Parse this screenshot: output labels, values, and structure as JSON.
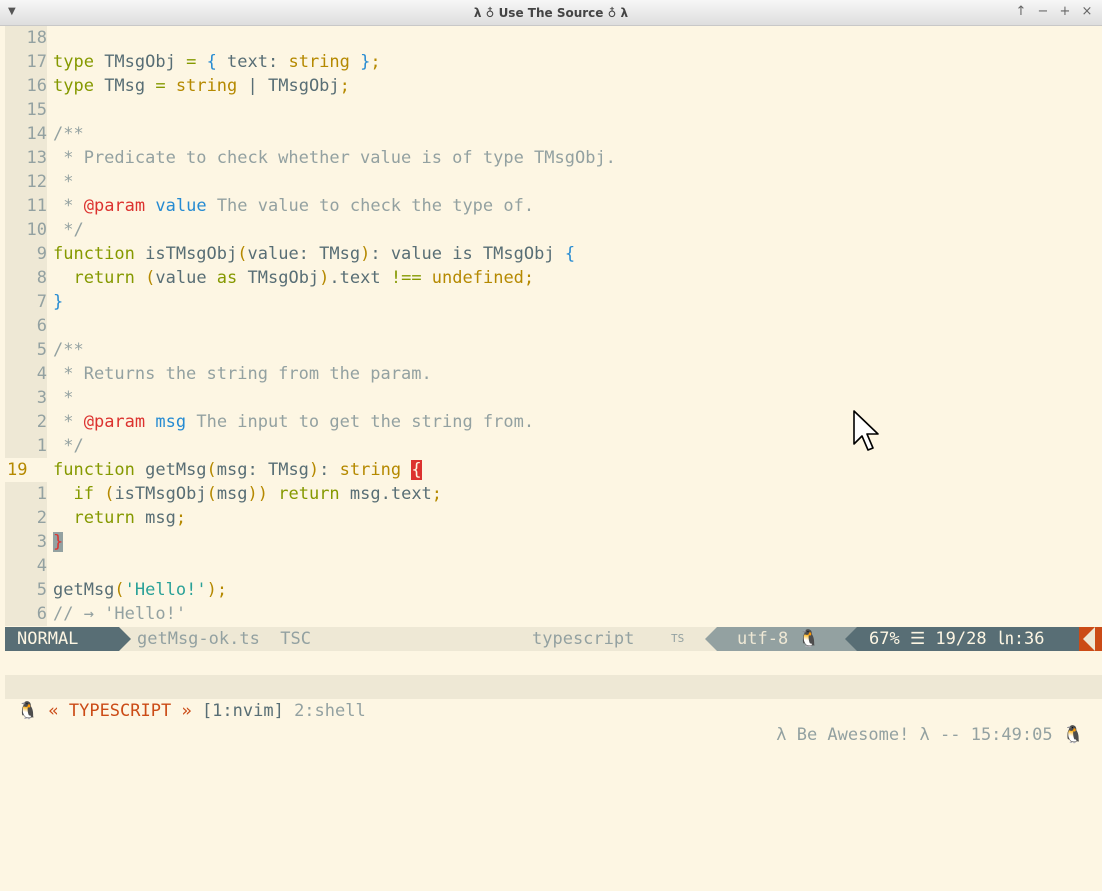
{
  "window": {
    "title": "λ ♁ Use The Source ♁ λ",
    "controls": [
      "↑",
      "−",
      "+",
      "×"
    ]
  },
  "editor": {
    "lines": [
      {
        "num": "18",
        "current": false,
        "segments": []
      },
      {
        "num": "17",
        "current": false,
        "segments": [
          {
            "t": "type ",
            "c": "kw"
          },
          {
            "t": "TMsgObj ",
            "c": "pr"
          },
          {
            "t": "= ",
            "c": "kw"
          },
          {
            "t": "{ ",
            "c": "br"
          },
          {
            "t": "text: ",
            "c": "pr"
          },
          {
            "t": "string ",
            "c": "ty"
          },
          {
            "t": "}",
            "c": "br"
          },
          {
            "t": ";",
            "c": "ty"
          }
        ]
      },
      {
        "num": "16",
        "current": false,
        "segments": [
          {
            "t": "type ",
            "c": "kw"
          },
          {
            "t": "TMsg ",
            "c": "pr"
          },
          {
            "t": "= ",
            "c": "kw"
          },
          {
            "t": "string ",
            "c": "ty"
          },
          {
            "t": "| ",
            "c": "pr"
          },
          {
            "t": "TMsgObj",
            "c": "pr"
          },
          {
            "t": ";",
            "c": "ty"
          }
        ]
      },
      {
        "num": "15",
        "current": false,
        "segments": []
      },
      {
        "num": "14",
        "current": false,
        "segments": [
          {
            "t": "/**",
            "c": "cm"
          }
        ]
      },
      {
        "num": "13",
        "current": false,
        "segments": [
          {
            "t": " * Predicate to check whether value is of type TMsgObj.",
            "c": "cm"
          }
        ]
      },
      {
        "num": "12",
        "current": false,
        "segments": [
          {
            "t": " *",
            "c": "cm"
          }
        ]
      },
      {
        "num": "11",
        "current": false,
        "segments": [
          {
            "t": " * ",
            "c": "cm"
          },
          {
            "t": "@param",
            "c": "tag"
          },
          {
            "t": " ",
            "c": "cm"
          },
          {
            "t": "value",
            "c": "pn"
          },
          {
            "t": " The value to check the type of.",
            "c": "cm"
          }
        ]
      },
      {
        "num": "10",
        "current": false,
        "segments": [
          {
            "t": " */",
            "c": "cm"
          }
        ]
      },
      {
        "num": "9",
        "current": false,
        "segments": [
          {
            "t": "function ",
            "c": "kw"
          },
          {
            "t": "isTMsgObj",
            "c": "pr"
          },
          {
            "t": "(",
            "c": "ty"
          },
          {
            "t": "value: TMsg",
            "c": "pr"
          },
          {
            "t": ")",
            "c": "ty"
          },
          {
            "t": ": value is TMsgObj ",
            "c": "pr"
          },
          {
            "t": "{",
            "c": "br"
          }
        ]
      },
      {
        "num": "8",
        "current": false,
        "segments": [
          {
            "t": "  return ",
            "c": "kw"
          },
          {
            "t": "(",
            "c": "ty"
          },
          {
            "t": "value ",
            "c": "pr"
          },
          {
            "t": "as ",
            "c": "kw"
          },
          {
            "t": "TMsgObj",
            "c": "pr"
          },
          {
            "t": ")",
            "c": "ty"
          },
          {
            "t": ".text ",
            "c": "pr"
          },
          {
            "t": "!== ",
            "c": "kw"
          },
          {
            "t": "undefined",
            "c": "ty"
          },
          {
            "t": ";",
            "c": "ty"
          }
        ]
      },
      {
        "num": "7",
        "current": false,
        "segments": [
          {
            "t": "}",
            "c": "br"
          }
        ]
      },
      {
        "num": "6",
        "current": false,
        "segments": []
      },
      {
        "num": "5",
        "current": false,
        "segments": [
          {
            "t": "/**",
            "c": "cm"
          }
        ]
      },
      {
        "num": "4",
        "current": false,
        "segments": [
          {
            "t": " * Returns the string from the param.",
            "c": "cm"
          }
        ]
      },
      {
        "num": "3",
        "current": false,
        "segments": [
          {
            "t": " *",
            "c": "cm"
          }
        ]
      },
      {
        "num": "2",
        "current": false,
        "segments": [
          {
            "t": " * ",
            "c": "cm"
          },
          {
            "t": "@param",
            "c": "tag"
          },
          {
            "t": " ",
            "c": "cm"
          },
          {
            "t": "msg",
            "c": "pn"
          },
          {
            "t": " The input to get the string from.",
            "c": "cm"
          }
        ]
      },
      {
        "num": "1",
        "current": false,
        "segments": [
          {
            "t": " */",
            "c": "cm"
          }
        ]
      },
      {
        "num": "19",
        "current": true,
        "segments": [
          {
            "t": "function ",
            "c": "kw"
          },
          {
            "t": "getMsg",
            "c": "pr"
          },
          {
            "t": "(",
            "c": "ty"
          },
          {
            "t": "msg: TMsg",
            "c": "pr"
          },
          {
            "t": ")",
            "c": "ty"
          },
          {
            "t": ": ",
            "c": "pr"
          },
          {
            "t": "string ",
            "c": "ty"
          },
          {
            "t": "{",
            "c": "hl"
          }
        ]
      },
      {
        "num": "1",
        "current": false,
        "segments": [
          {
            "t": "  if ",
            "c": "kw"
          },
          {
            "t": "(",
            "c": "ty"
          },
          {
            "t": "isTMsgObj",
            "c": "pr"
          },
          {
            "t": "(",
            "c": "ty"
          },
          {
            "t": "msg",
            "c": "pr"
          },
          {
            "t": ")) ",
            "c": "ty"
          },
          {
            "t": "return ",
            "c": "kw"
          },
          {
            "t": "msg.text",
            "c": "pr"
          },
          {
            "t": ";",
            "c": "ty"
          }
        ]
      },
      {
        "num": "2",
        "current": false,
        "segments": [
          {
            "t": "  return ",
            "c": "kw"
          },
          {
            "t": "msg",
            "c": "pr"
          },
          {
            "t": ";",
            "c": "ty"
          }
        ]
      },
      {
        "num": "3",
        "current": false,
        "segments": [
          {
            "t": "}",
            "c": "hl2"
          }
        ]
      },
      {
        "num": "4",
        "current": false,
        "segments": []
      },
      {
        "num": "5",
        "current": false,
        "segments": [
          {
            "t": "getMsg",
            "c": "pr"
          },
          {
            "t": "(",
            "c": "ty"
          },
          {
            "t": "'Hello!'",
            "c": "str"
          },
          {
            "t": ")",
            "c": "ty"
          },
          {
            "t": ";",
            "c": "ty"
          }
        ]
      },
      {
        "num": "6",
        "current": false,
        "segments": [
          {
            "t": "// → 'Hello!'",
            "c": "cm"
          }
        ]
      }
    ]
  },
  "statusline": {
    "mode": "NORMAL",
    "filename": "getMsg-ok.ts  TSC",
    "filetype": "typescript",
    "filetype_icon": "TS",
    "encoding": "utf-8 🐧",
    "position": "67% ☰ 19/28 ㏑:36"
  },
  "tmux": {
    "session": "🐧 « TYPESCRIPT » ",
    "window1": "[1:nvim]",
    "window2": " 2:shell",
    "right": "λ Be Awesome! λ -- 15:49:05 🐧"
  }
}
